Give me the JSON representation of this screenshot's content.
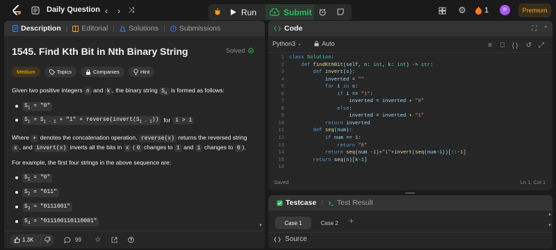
{
  "topbar": {
    "daily_label": "Daily Question",
    "run_label": "Run",
    "submit_label": "Submit",
    "streak_count": "1",
    "avatar_letter": "P",
    "premium_label": "Premium"
  },
  "left_tabs": {
    "description": "Description",
    "editorial": "Editorial",
    "solutions": "Solutions",
    "submissions": "Submissions"
  },
  "problem": {
    "title": "1545. Find Kth Bit in Nth Binary String",
    "status": "Solved",
    "chips": {
      "difficulty": "Medium",
      "topics": "Topics",
      "companies": "Companies",
      "hint": "Hint"
    },
    "intro_prefix": "Given two positive integers",
    "intro_n": "n",
    "intro_and": "and",
    "intro_k": "k",
    "intro_suffix": ", the binary string",
    "intro_tail": "is formed as follows:",
    "rule1": "= \"0\"",
    "rule2_a": "= S",
    "rule2_b": "+ \"1\" + reverse(invert(S",
    "rule2_c": "))",
    "rule2_for": "for",
    "rule2_cond": "i > 1",
    "para2_a": "Where",
    "para2_plus": "+",
    "para2_b": "denotes the concatenation operation,",
    "para2_rev": "reverse(x)",
    "para2_c": "returns the reversed string",
    "para2_x": "x",
    "para2_d": ", and",
    "para2_inv": "invert(x)",
    "para2_e": "inverts all the bits in",
    "para2_f": "(",
    "para2_zero": "0",
    "para2_g": "changes to",
    "para2_one": "1",
    "para2_h": "and",
    "para2_one_b": "1",
    "para2_i": "changes to",
    "para2_zero_b": "0",
    "para2_j": ").",
    "example_intro": "For example, the first four strings in the above sequence are:",
    "examples": [
      {
        "sub": "1",
        "val": "= \"0\""
      },
      {
        "sub": "2",
        "val": "= \"011\""
      },
      {
        "sub": "3",
        "val": "= \"0111001\""
      },
      {
        "sub": "4",
        "val": "= \"011100110110001\""
      }
    ]
  },
  "bottom": {
    "likes": "1.3K",
    "comments": "99"
  },
  "editor": {
    "header_label": "Code",
    "language": "Python3",
    "mode": "Auto",
    "saved": "Saved",
    "position": "Ln 1, Col 1",
    "lines": [
      "class Solution:",
      "    def findKthBit(self, n: int, k: int) -> str:",
      "        def invert(s):",
      "            inverted = \"\"",
      "            for i in s:",
      "                if i == \"1\":",
      "                    inverted = inverted + \"0\"",
      "                else:",
      "                    inverted = inverted + \"1\"",
      "            return inverted",
      "        def seq(num):",
      "            if num == 1:",
      "                return \"0\"",
      "            return seq(num -1)+\"1\"+invert(seq(num-1))[::-1]",
      "        return seq(n)[k-1]",
      ""
    ]
  },
  "testpanel": {
    "testcase_label": "Testcase",
    "result_label": "Test Result",
    "case1": "Case 1",
    "case2": "Case 2",
    "source_label": "Source"
  }
}
